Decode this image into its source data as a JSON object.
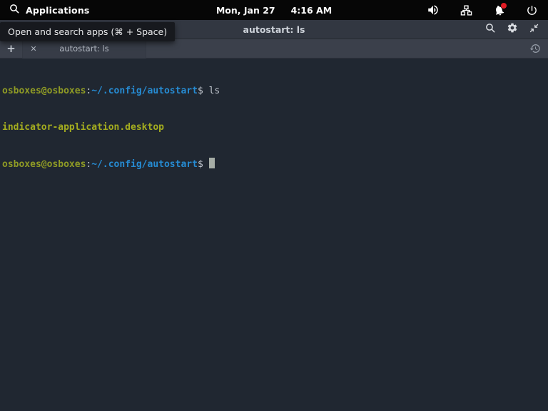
{
  "topbar": {
    "search_icon": "magnifier",
    "applications_label": "Applications",
    "date": "Mon, Jan 27",
    "time": "4:16 AM",
    "tray_icons": [
      "volume",
      "network",
      "notifications",
      "power"
    ],
    "notification_badge_color": "#e01b24"
  },
  "tooltip": {
    "text": "Open and search apps (⌘ + Space)"
  },
  "titlebar": {
    "title": "autostart: ls",
    "icons": [
      "search",
      "settings",
      "compress"
    ]
  },
  "tabbar": {
    "new_tab_label": "+",
    "tab": {
      "close_glyph": "✕",
      "label": "autostart: ls"
    },
    "history_icon": "history"
  },
  "terminal": {
    "lines": [
      {
        "user": "osboxes@osboxes",
        "sep": ":",
        "path": "~/.config/autostart",
        "sym": "$ ",
        "cmd": "ls"
      },
      {
        "text": "indicator-application.desktop"
      },
      {
        "user": "osboxes@osboxes",
        "sep": ":",
        "path": "~/.config/autostart",
        "sym": "$ ",
        "cursor": true
      }
    ],
    "colors": {
      "background": "#202731",
      "foreground": "#bfc5cd",
      "prompt_green": "#8f9b25",
      "output_green": "#a4ad1f",
      "path_blue": "#268bd2",
      "cursor": "#a6ada6"
    }
  }
}
